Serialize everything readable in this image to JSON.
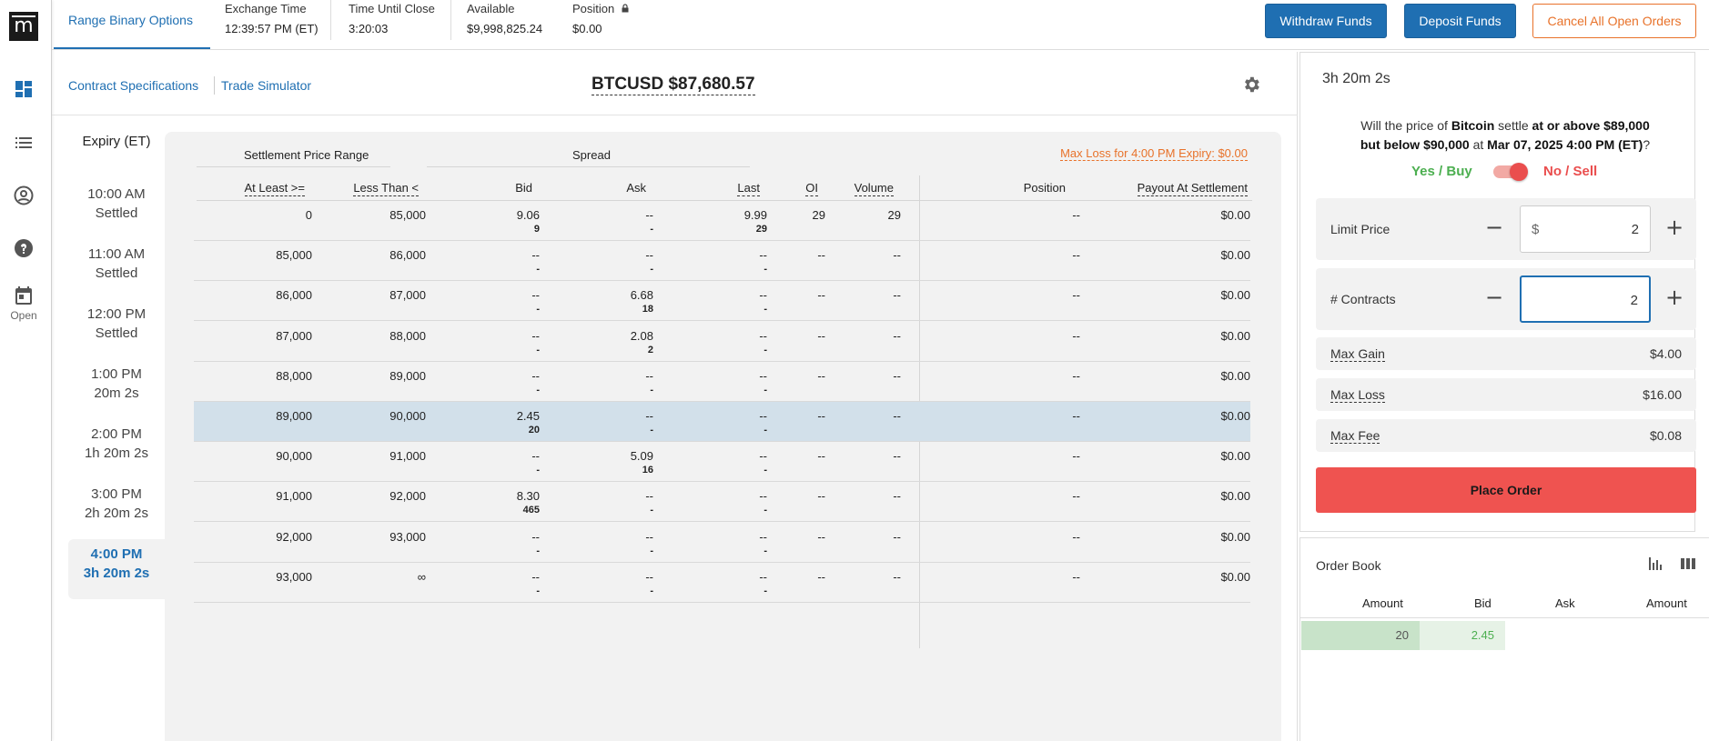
{
  "rail": {
    "logo": "m",
    "open_label": "Open"
  },
  "topbar": {
    "tab": "Range Binary Options",
    "stats": [
      {
        "label": "Exchange Time",
        "value": "12:39:57 PM (ET)"
      },
      {
        "label": "Time Until Close",
        "value": "3:20:03"
      },
      {
        "label": "Available",
        "value": "$9,998,825.24"
      },
      {
        "label": "Position",
        "value": "$0.00"
      }
    ],
    "withdraw_label": "Withdraw Funds",
    "deposit_label": "Deposit Funds",
    "cancel_label": "Cancel All Open Orders"
  },
  "subbar": {
    "specs_link": "Contract Specifications",
    "simulator_link": "Trade Simulator",
    "ticker": "BTCUSD $87,680.57"
  },
  "expiry": {
    "title": "Expiry (ET)",
    "items": [
      {
        "time": "10:00 AM",
        "status": "Settled"
      },
      {
        "time": "11:00 AM",
        "status": "Settled"
      },
      {
        "time": "12:00 PM",
        "status": "Settled"
      },
      {
        "time": "1:00 PM",
        "status": "20m 2s"
      },
      {
        "time": "2:00 PM",
        "status": "1h 20m 2s"
      },
      {
        "time": "3:00 PM",
        "status": "2h 20m 2s"
      },
      {
        "time": "4:00 PM",
        "status": "3h 20m 2s"
      }
    ]
  },
  "grid": {
    "group_range": "Settlement Price Range",
    "group_spread": "Spread",
    "max_loss": "Max Loss for 4:00 PM Expiry: $0.00",
    "headers": {
      "at_least": "At Least >=",
      "less_than": "Less Than <",
      "bid": "Bid",
      "ask": "Ask",
      "last": "Last",
      "oi": "OI",
      "volume": "Volume",
      "position": "Position",
      "payout": "Payout At Settlement"
    },
    "rows": [
      {
        "at_least": "0",
        "less_than": "85,000",
        "bid": "9.06",
        "bid_qty": "9",
        "ask": "--",
        "ask_qty": "-",
        "last": "9.99",
        "last_qty": "29",
        "oi": "29",
        "volume": "29",
        "position": "--",
        "payout": "$0.00"
      },
      {
        "at_least": "85,000",
        "less_than": "86,000",
        "bid": "--",
        "bid_qty": "-",
        "ask": "--",
        "ask_qty": "-",
        "last": "--",
        "last_qty": "-",
        "oi": "--",
        "volume": "--",
        "position": "--",
        "payout": "$0.00"
      },
      {
        "at_least": "86,000",
        "less_than": "87,000",
        "bid": "--",
        "bid_qty": "-",
        "ask": "6.68",
        "ask_qty": "18",
        "last": "--",
        "last_qty": "-",
        "oi": "--",
        "volume": "--",
        "position": "--",
        "payout": "$0.00"
      },
      {
        "at_least": "87,000",
        "less_than": "88,000",
        "bid": "--",
        "bid_qty": "-",
        "ask": "2.08",
        "ask_qty": "2",
        "last": "--",
        "last_qty": "-",
        "oi": "--",
        "volume": "--",
        "position": "--",
        "payout": "$0.00"
      },
      {
        "at_least": "88,000",
        "less_than": "89,000",
        "bid": "--",
        "bid_qty": "-",
        "ask": "--",
        "ask_qty": "-",
        "last": "--",
        "last_qty": "-",
        "oi": "--",
        "volume": "--",
        "position": "--",
        "payout": "$0.00"
      },
      {
        "at_least": "89,000",
        "less_than": "90,000",
        "bid": "2.45",
        "bid_qty": "20",
        "ask": "--",
        "ask_qty": "-",
        "last": "--",
        "last_qty": "-",
        "oi": "--",
        "volume": "--",
        "position": "--",
        "payout": "$0.00"
      },
      {
        "at_least": "90,000",
        "less_than": "91,000",
        "bid": "--",
        "bid_qty": "-",
        "ask": "5.09",
        "ask_qty": "16",
        "last": "--",
        "last_qty": "-",
        "oi": "--",
        "volume": "--",
        "position": "--",
        "payout": "$0.00"
      },
      {
        "at_least": "91,000",
        "less_than": "92,000",
        "bid": "8.30",
        "bid_qty": "465",
        "ask": "--",
        "ask_qty": "-",
        "last": "--",
        "last_qty": "-",
        "oi": "--",
        "volume": "--",
        "position": "--",
        "payout": "$0.00"
      },
      {
        "at_least": "92,000",
        "less_than": "93,000",
        "bid": "--",
        "bid_qty": "-",
        "ask": "--",
        "ask_qty": "-",
        "last": "--",
        "last_qty": "-",
        "oi": "--",
        "volume": "--",
        "position": "--",
        "payout": "$0.00"
      },
      {
        "at_least": "93,000",
        "less_than": "∞",
        "bid": "--",
        "bid_qty": "-",
        "ask": "--",
        "ask_qty": "-",
        "last": "--",
        "last_qty": "-",
        "oi": "--",
        "volume": "--",
        "position": "--",
        "payout": "$0.00"
      }
    ]
  },
  "order": {
    "timer": "3h 20m 2s",
    "q_pre": "Will the price of ",
    "q_asset": "Bitcoin",
    "q_mid": " settle ",
    "q_cond": "at or above $89,000",
    "q_mid2": "but below $90,000",
    "q_at": " at ",
    "q_date": "Mar 07, 2025 4:00 PM (ET)",
    "q_end": "?",
    "yes_label": "Yes / Buy",
    "no_label": "No / Sell",
    "limit_label": "Limit Price",
    "limit_prefix": "$",
    "limit_value": "2",
    "contracts_label": "# Contracts",
    "contracts_value": "2",
    "max_gain_label": "Max Gain",
    "max_gain": "$4.00",
    "max_loss_label": "Max Loss",
    "max_loss": "$16.00",
    "max_fee_label": "Max Fee",
    "max_fee": "$0.08",
    "place_label": "Place Order"
  },
  "orderbook": {
    "title": "Order Book",
    "headers": [
      "Amount",
      "Bid",
      "Ask",
      "Amount"
    ],
    "bid_amount": "20",
    "bid_price": "2.45"
  },
  "colors": {
    "accent": "#1f6fb2",
    "warn": "#e8722a",
    "buy": "#4caf50",
    "sell": "#ea4e4e",
    "highlight_row": "#d2e0ea"
  }
}
